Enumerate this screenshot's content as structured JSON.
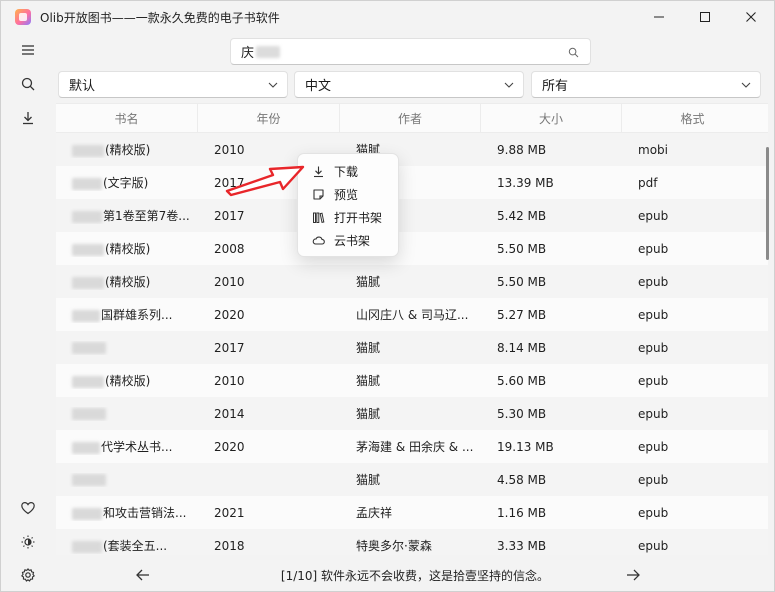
{
  "app": {
    "title": "Olib开放图书——一款永久免费的电子书软件"
  },
  "window_controls": [
    "minimize-icon",
    "maximize-icon",
    "close-icon"
  ],
  "sidebar": {
    "icons": [
      "menu-icon",
      "search-icon",
      "download-icon",
      "heart-icon",
      "theme-icon",
      "settings-icon"
    ]
  },
  "search": {
    "value": "庆"
  },
  "filters": {
    "sort": "默认",
    "language": "中文",
    "format": "所有"
  },
  "table": {
    "columns": [
      "书名",
      "年份",
      "作者",
      "大小",
      "格式"
    ],
    "rows": [
      {
        "title": "(精校版)",
        "year": "2010",
        "author": "猫腻",
        "size": "9.88 MB",
        "format": "mobi"
      },
      {
        "title": "(文字版)",
        "year": "2017",
        "author": "",
        "size": "13.39 MB",
        "format": "pdf"
      },
      {
        "title": "第1卷至第7卷...",
        "year": "2017",
        "author": "",
        "size": "5.42 MB",
        "format": "epub"
      },
      {
        "title": "(精校版)",
        "year": "2008",
        "author": "",
        "size": "5.50 MB",
        "format": "epub"
      },
      {
        "title": "(精校版)",
        "year": "2010",
        "author": "猫腻",
        "size": "5.50 MB",
        "format": "epub"
      },
      {
        "title": "国群雄系列...",
        "year": "2020",
        "author": "山冈庄八 & 司马辽...",
        "size": "5.27 MB",
        "format": "epub"
      },
      {
        "title": "",
        "year": "2017",
        "author": "猫腻",
        "size": "8.14 MB",
        "format": "epub"
      },
      {
        "title": "(精校版)",
        "year": "2010",
        "author": "猫腻",
        "size": "5.60 MB",
        "format": "epub"
      },
      {
        "title": "",
        "year": "2014",
        "author": "猫腻",
        "size": "5.30 MB",
        "format": "epub"
      },
      {
        "title": "代学术丛书...",
        "year": "2020",
        "author": "茅海建 & 田余庆 & ...",
        "size": "19.13 MB",
        "format": "epub"
      },
      {
        "title": "",
        "year": "",
        "author": "猫腻",
        "size": "4.58 MB",
        "format": "epub"
      },
      {
        "title": "和攻击营销法...",
        "year": "2021",
        "author": "孟庆祥",
        "size": "1.16 MB",
        "format": "epub"
      },
      {
        "title": "(套装全五...",
        "year": "2018",
        "author": "特奥多尔·蒙森",
        "size": "3.33 MB",
        "format": "epub"
      }
    ]
  },
  "context_menu": {
    "items": [
      {
        "label": "下载",
        "icon": "download-icon"
      },
      {
        "label": "预览",
        "icon": "preview-icon"
      },
      {
        "label": "打开书架",
        "icon": "bookshelf-icon"
      },
      {
        "label": "云书架",
        "icon": "cloud-icon"
      }
    ]
  },
  "footer": {
    "message": "[1/10] 软件永远不会收费，这是拾壹坚持的信念。"
  },
  "colors": {
    "annotation_arrow": "#e8262a",
    "background": "#f3f3f3"
  }
}
